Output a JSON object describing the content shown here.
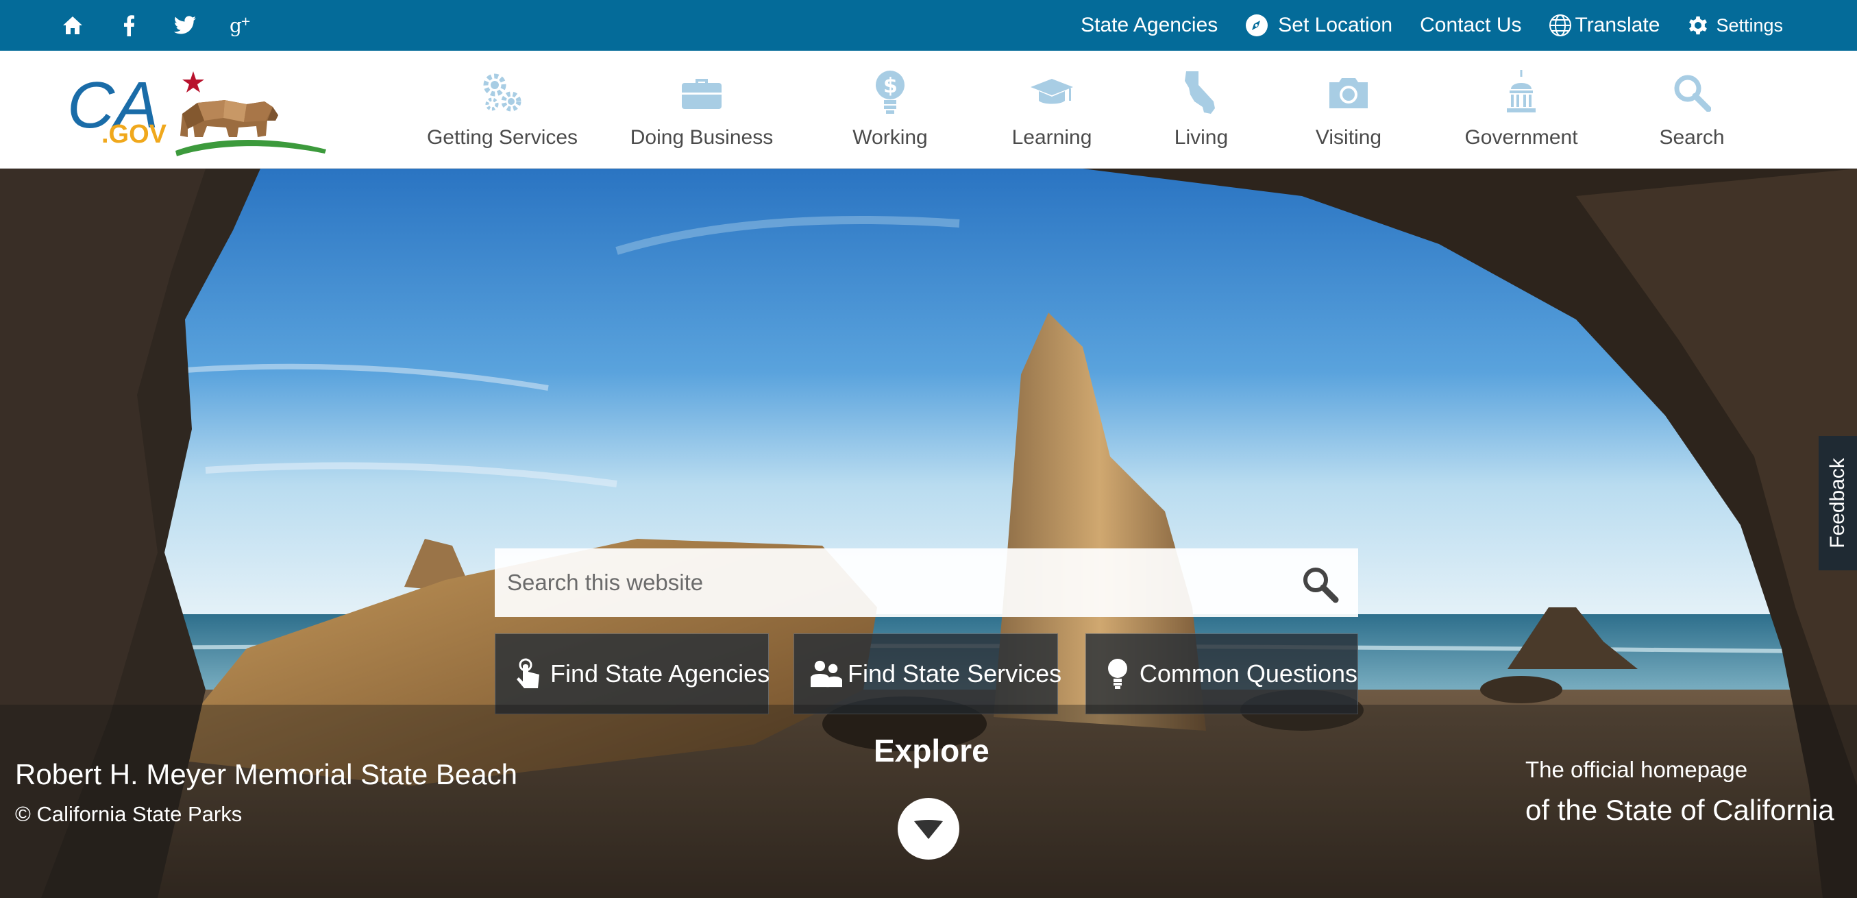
{
  "utility": {
    "social": [
      "home-icon",
      "facebook-icon",
      "twitter-icon",
      "google-plus-icon"
    ],
    "links": {
      "state_agencies": "State Agencies",
      "set_location": "Set Location",
      "contact_us": "Contact Us",
      "translate": "Translate",
      "settings": "Settings"
    }
  },
  "logo": {
    "text_ca": "CA",
    "text_gov": ".GOV"
  },
  "nav": {
    "items": [
      {
        "label": "Getting Services",
        "icon": "gears-icon"
      },
      {
        "label": "Doing Business",
        "icon": "briefcase-icon"
      },
      {
        "label": "Working",
        "icon": "lightbulb-dollar-icon"
      },
      {
        "label": "Learning",
        "icon": "graduation-cap-icon"
      },
      {
        "label": "Living",
        "icon": "california-map-icon"
      },
      {
        "label": "Visiting",
        "icon": "camera-icon"
      },
      {
        "label": "Government",
        "icon": "capitol-icon"
      },
      {
        "label": "Search",
        "icon": "search-icon"
      }
    ]
  },
  "hero": {
    "search_placeholder": "Search this website",
    "quick_links": {
      "agencies": "Find State Agencies",
      "services": "Find State Services",
      "questions": "Common Questions"
    },
    "feedback": "Feedback",
    "caption_title": "Robert H. Meyer Memorial State Beach",
    "caption_credit": "© California State Parks",
    "explore": "Explore",
    "official_line1": "The official homepage",
    "official_line2": "of the State of California"
  },
  "colors": {
    "utility_bar": "#046b99",
    "nav_icon": "#a8cde4",
    "nav_text": "#4b4b4b",
    "logo_blue": "#1a6ca8",
    "logo_orange": "#f0a81c"
  }
}
